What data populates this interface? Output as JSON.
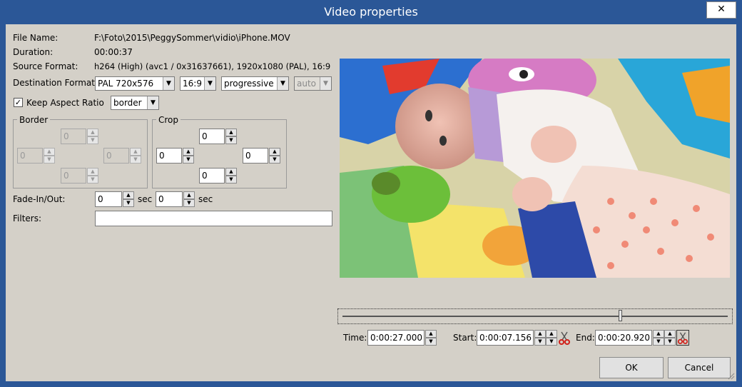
{
  "window": {
    "title": "Video properties",
    "close_glyph": "✕"
  },
  "labels": {
    "file_name": "File Name:",
    "duration": "Duration:",
    "source_format": "Source Format:",
    "destination_format": "Destination Format:",
    "keep_aspect": "Keep Aspect Ratio",
    "border_group": "Border",
    "crop_group": "Crop",
    "fade": "Fade-In/Out:",
    "sec": "sec",
    "filters": "Filters:",
    "time": "Time:",
    "start": "Start:",
    "end": "End:"
  },
  "values": {
    "file_name": "F:\\Foto\\2015\\PeggySommer\\vidio\\iPhone.MOV",
    "duration": "00:00:37",
    "source_format": "h264 (High) (avc1 / 0x31637661), 1920x1080 (PAL), 16:9"
  },
  "destination": {
    "format": "PAL 720x576",
    "aspect": "16:9",
    "scan": "progressive",
    "field": "auto"
  },
  "keep_aspect": {
    "checked": true,
    "mode": "border"
  },
  "border": {
    "top": "0",
    "left": "0",
    "right": "0",
    "bottom": "0"
  },
  "crop": {
    "top": "0",
    "left": "0",
    "right": "0",
    "bottom": "0"
  },
  "fade": {
    "in": "0",
    "out": "0"
  },
  "filters": {
    "value": ""
  },
  "timeline": {
    "position_fraction": 0.72
  },
  "times": {
    "time": "0:00:27.000",
    "start": "0:00:07.156",
    "end": "0:00:20.920"
  },
  "buttons": {
    "ok": "OK",
    "cancel": "Cancel"
  },
  "icons": {
    "check": "✓",
    "arrow_down": "▼",
    "arrow_up": "▲",
    "scissors": "scissors-icon",
    "close": "close-icon",
    "grip": "resize-grip-icon"
  },
  "colors": {
    "titlebar": "#2b5797",
    "client": "#d4d0c8"
  }
}
